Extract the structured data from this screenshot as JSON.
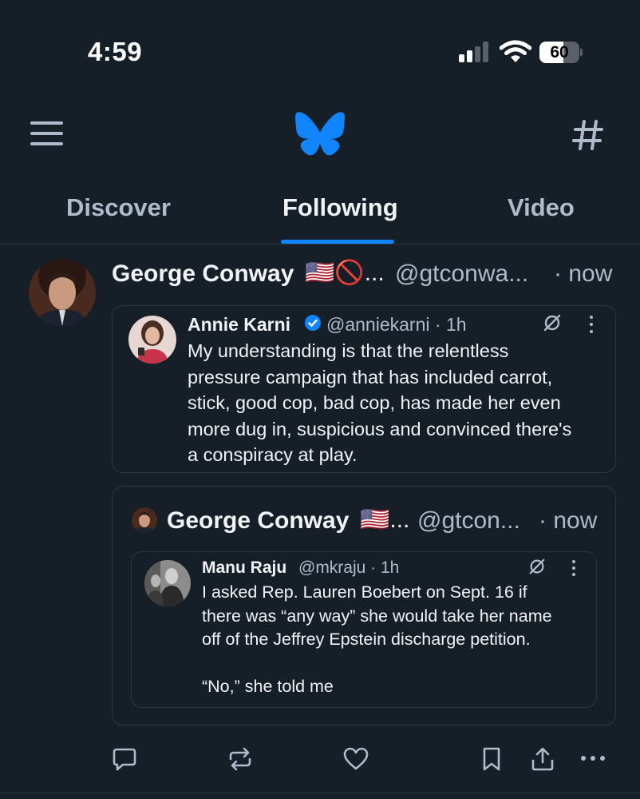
{
  "status_bar": {
    "time": "4:59",
    "battery_percent": "60",
    "battery_level": 0.6
  },
  "header": {
    "menu_icon": "hamburger-menu-icon",
    "logo_icon": "butterfly-logo-icon",
    "feeds_icon": "hashtag-icon"
  },
  "tabs": [
    {
      "label": "Discover",
      "active": false
    },
    {
      "label": "Following",
      "active": true
    },
    {
      "label": "Video",
      "active": false
    }
  ],
  "post": {
    "author": "George Conway",
    "flair": "🇺🇸🚫...",
    "handle": "@gtconwa...",
    "time": "· now",
    "quote": {
      "author": "Annie Karni",
      "handle": "@anniekarni · 1h",
      "text": "My understanding is that the relentless\npressure campaign that has included carrot,\nstick, good cop, bad cop, has made her even\nmore dug in, suspicious and convinced there's\na conspiracy at play."
    },
    "quote_post": {
      "author": "George Conway",
      "flair": "🇺🇸...",
      "handle": "@gtcon...",
      "time": "· now",
      "quote": {
        "author": "Manu Raju",
        "handle": "@mkraju · 1h",
        "text": "I asked Rep. Lauren Boebert on Sept. 16 if\nthere was “any way” she would take her name\noff of the Jeffrey Epstein discharge petition.\n\n“No,” she told me"
      }
    },
    "actions": [
      "reply-icon",
      "repost-icon",
      "like-icon",
      "bookmark-icon",
      "share-icon",
      "more-icon"
    ]
  },
  "colors": {
    "background": "#161e27",
    "accent": "#1083fe",
    "muted": "#aebbca",
    "border": "#2c3744"
  }
}
